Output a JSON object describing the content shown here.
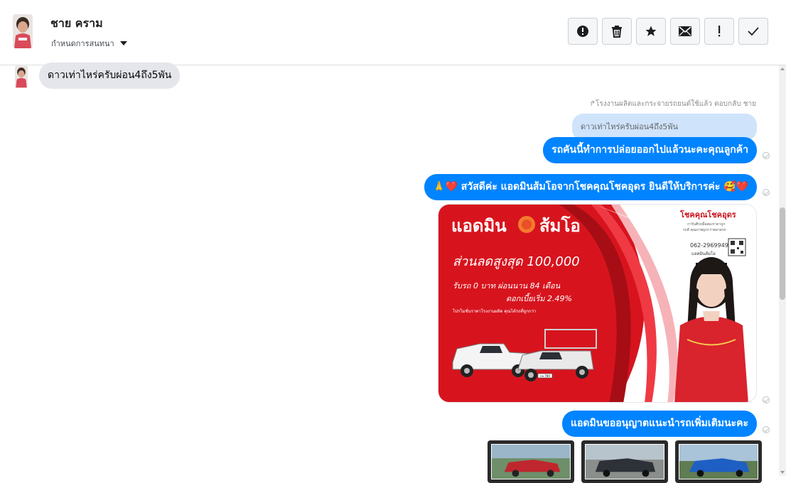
{
  "header": {
    "contact_name": "ชาย คราม",
    "assign_label": "กำหนดการสนทนา",
    "actions": [
      {
        "name": "spam-button",
        "icon": "alert-circle-icon"
      },
      {
        "name": "delete-button",
        "icon": "trash-icon"
      },
      {
        "name": "star-button",
        "icon": "star-icon"
      },
      {
        "name": "mark-unread-button",
        "icon": "envelope-icon"
      },
      {
        "name": "important-button",
        "icon": "exclamation-icon"
      },
      {
        "name": "done-button",
        "icon": "check-icon"
      }
    ]
  },
  "messages": {
    "incoming_1": "ดาวเท่าไหร่ครับผ่อน4ถึง5พัน",
    "reply_meta": "โรงงานผลิตและกระจายรถยนต์ใช้แล้ว ตอบกลับ ชาย",
    "reply_quote": "ดาวเท่าไหร่ครับผ่อน4ถึง5พัน",
    "outgoing_1": "รถคันนี้ทำการปล่อยออกไปแล้วนะคะคุณลูกค้า",
    "outgoing_2": "🙏❤️ สวัสดีค่ะ แอดมินส้มโอจากโชคคุณโชคอุดร ยินดีให้บริการค่ะ 🥰❤️",
    "outgoing_3": "แอดมินขออนุญาตแนะนำรถเพิ่มเติมนะคะ"
  },
  "promo": {
    "title": "แอดมิน",
    "title2": "ส้มโอ",
    "discount": "ส่วนลดสูงสุด 100,000",
    "terms": "รับรถ 0 บาท ผ่อนนาน 84 เดือน",
    "interest": "ดอกเบี้ยเริ่ม 2.49%",
    "fineprint": "โปรโมชั่นราคาโรงงานผลิต คุณได้รถที่ถูกกว่า",
    "brand": "โชคคุณโชคอุดร",
    "brand_sub": "การันตีรถมือสองราคาถูก",
    "brand_sub2": "รถดี คุณภาพถูกกว่าตลาดรถ",
    "phone": "062-2969949",
    "phone_label": "แอดมินส้มโอ",
    "plate": "กษ 789"
  },
  "colors": {
    "accent": "#0084ff",
    "promo_red": "#d7141e"
  }
}
